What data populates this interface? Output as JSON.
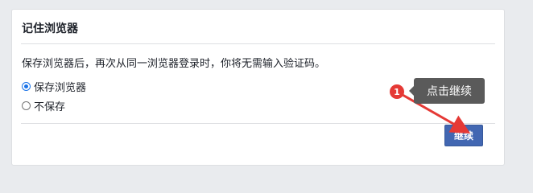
{
  "card": {
    "title": "记住浏览器",
    "description": "保存浏览器后，再次从同一浏览器登录时，你将无需输入验证码。",
    "options": [
      {
        "label": "保存浏览器",
        "checked": true
      },
      {
        "label": "不保存",
        "checked": false
      }
    ],
    "continue_label": "继续"
  },
  "annotation": {
    "step_number": "1",
    "tooltip_text": "点击继续",
    "accent_color": "#e53935"
  },
  "colors": {
    "button_bg": "#4267b2",
    "radio_checked": "#1a73e8"
  }
}
